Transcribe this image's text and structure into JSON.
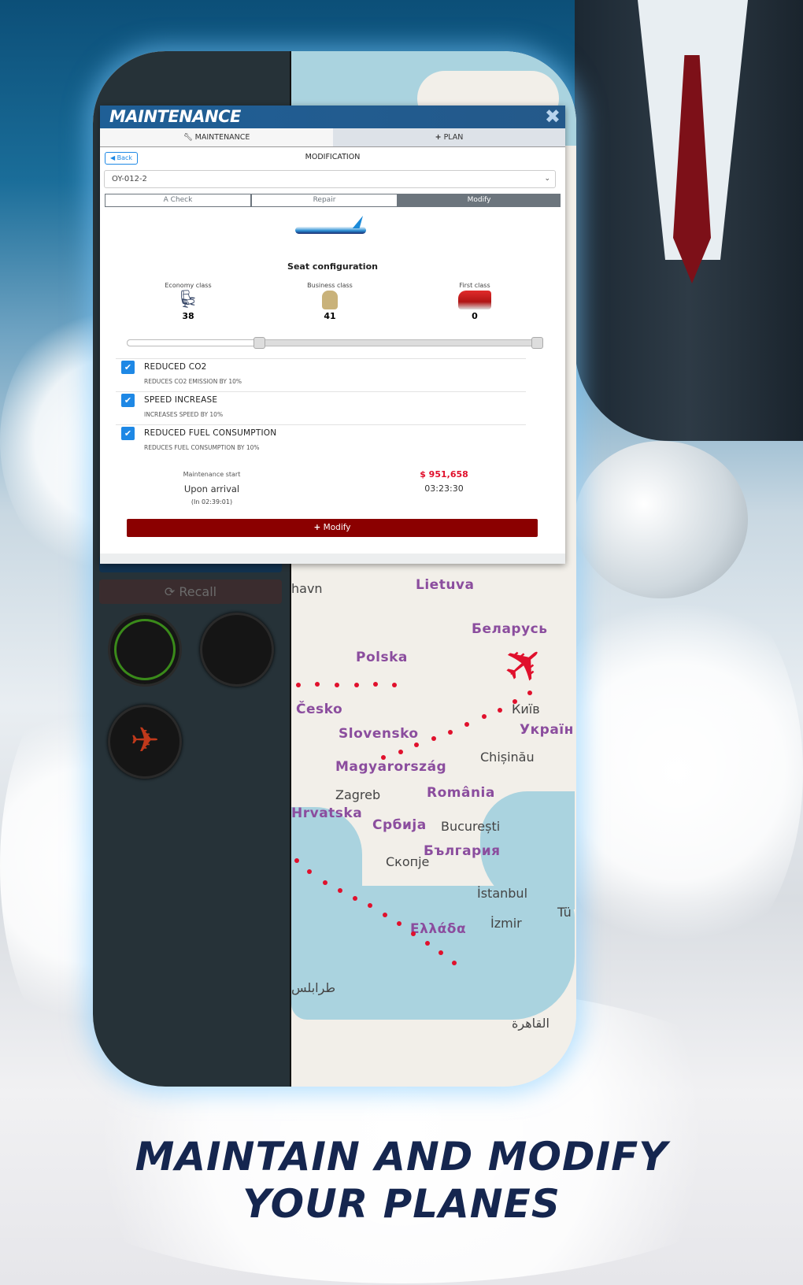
{
  "modal": {
    "title": "MAINTENANCE",
    "tabs": [
      {
        "label": "MAINTENANCE",
        "icon": "wrench-icon",
        "active": true
      },
      {
        "label": "PLAN",
        "icon": "plus-icon",
        "active": false
      }
    ],
    "back_label": "Back",
    "section_title": "MODIFICATION",
    "aircraft_select": "OY-012-2",
    "segments": [
      {
        "label": "A Check",
        "active": false
      },
      {
        "label": "Repair",
        "active": false
      },
      {
        "label": "Modify",
        "active": true
      }
    ],
    "seat_title": "Seat configuration",
    "seats": [
      {
        "label": "Economy class",
        "value": "38"
      },
      {
        "label": "Business class",
        "value": "41"
      },
      {
        "label": "First class",
        "value": "0"
      }
    ],
    "slider_percent": 32,
    "options": [
      {
        "title": "REDUCED CO2",
        "desc": "REDUCES CO2 EMISSION BY 10%",
        "checked": true
      },
      {
        "title": "SPEED INCREASE",
        "desc": "INCREASES SPEED BY 10%",
        "checked": true
      },
      {
        "title": "REDUCED FUEL CONSUMPTION",
        "desc": "REDUCES FUEL CONSUMPTION BY 10%",
        "checked": true
      }
    ],
    "maintenance_start_label": "Maintenance start",
    "maintenance_start_value": "Upon arrival",
    "maintenance_start_eta": "(In 02:39:01)",
    "price": "$ 951,658",
    "duration": "03:23:30",
    "modify_label": "Modify",
    "colors": {
      "header": "#1f5f96",
      "price": "#e0102c",
      "modify_button": "#8b0000",
      "checkbox": "#1e88e5"
    }
  },
  "sidebar": {
    "recall_label": "Recall"
  },
  "map": {
    "countries": [
      "Lietuva",
      "Беларусь",
      "Polska",
      "Česko",
      "Slovensko",
      "Magyarország",
      "România",
      "Hrvatska",
      "Србија",
      "България",
      "Ελλάδα",
      "Україн"
    ],
    "cities": [
      "Київ",
      "Chișinău",
      "Zagreb",
      "București",
      "Скопje",
      "İstanbul",
      "İzmir",
      "القاهرة",
      "طرابلس",
      "Tü",
      "havn"
    ]
  },
  "headline": [
    "MAINTAIN AND MODIFY",
    "YOUR PLANES"
  ]
}
